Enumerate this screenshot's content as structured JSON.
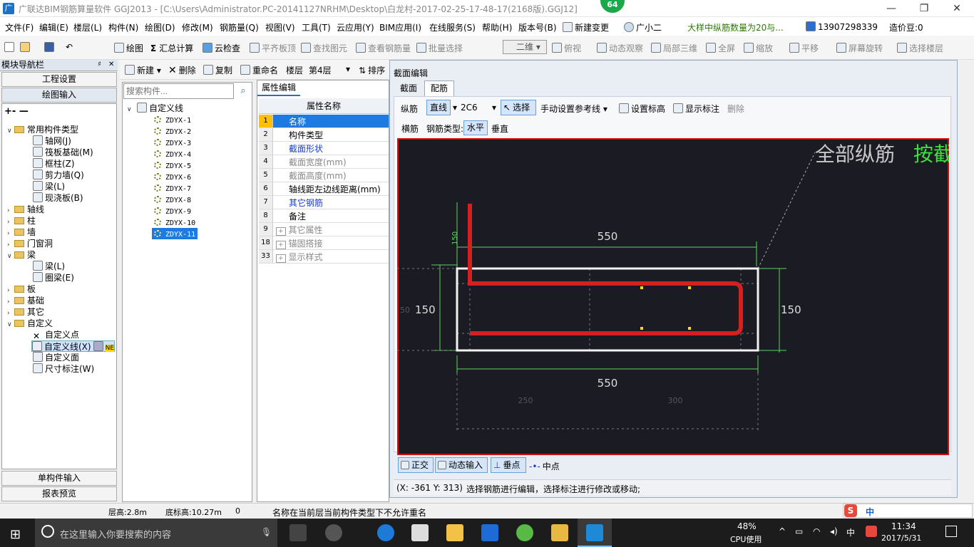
{
  "titlebar": {
    "app_icon": "广",
    "title": "广联达BIM钢筋算量软件 GGJ2013 - [C:\\Users\\Administrator.PC-20141127NRHM\\Desktop\\白龙村-2017-02-25-17-48-17(2168版).GGJ12]",
    "badge": "64",
    "minimize": "—",
    "maximize": "❐",
    "close": "✕"
  },
  "menu": {
    "items": [
      "文件(F)",
      "编辑(E)",
      "楼层(L)",
      "构件(N)",
      "绘图(D)",
      "修改(M)",
      "钢筋量(Q)",
      "视图(V)",
      "工具(T)",
      "云应用(Y)",
      "BIM应用(I)",
      "在线服务(S)",
      "帮助(H)",
      "版本号(B)",
      "新建变更",
      "广小二"
    ],
    "notice": "大样中纵筋数量为20与...",
    "phone": "13907298339",
    "price": "造价豆:0"
  },
  "toolbar": {
    "items": [
      "绘图",
      "汇总计算",
      "云检查",
      "平齐板顶",
      "查找图元",
      "查看钢筋量",
      "批量选择"
    ],
    "view_select": "二维",
    "items2": [
      "俯视",
      "动态观察",
      "局部三维",
      "全屏",
      "缩放",
      "平移",
      "屏幕旋转",
      "选择楼层"
    ]
  },
  "nav": {
    "header": "模块导航栏",
    "pin": "♯",
    "close": "✕",
    "engineering": "工程设置",
    "drawing_input": "绘图输入",
    "single_input": "单构件输入",
    "report_preview": "报表预览",
    "tree": [
      "常用构件类型",
      "轴网(J)",
      "筏板基础(M)",
      "框柱(Z)",
      "剪力墙(Q)",
      "梁(L)",
      "现浇板(B)",
      "轴线",
      "柱",
      "墙",
      "门窗洞",
      "梁",
      "梁(L)",
      "圈梁(E)",
      "板",
      "基础",
      "其它",
      "自定义",
      "自定义点",
      "自定义线(X)",
      "自定义面",
      "尺寸标注(W)"
    ],
    "ne_tag": "NE"
  },
  "comp": {
    "new": "新建",
    "delete": "删除",
    "copy": "复制",
    "rename": "重命名",
    "floor_label": "楼层",
    "floor": "第4层",
    "sort": "排序",
    "search_placeholder": "搜索构件...",
    "root": "自定义线",
    "items": [
      "ZDYX-1",
      "ZDYX-2",
      "ZDYX-3",
      "ZDYX-4",
      "ZDYX-5",
      "ZDYX-6",
      "ZDYX-7",
      "ZDYX-8",
      "ZDYX-9",
      "ZDYX-10",
      "ZDYX-11"
    ]
  },
  "props": {
    "tab": "属性编辑",
    "header": "属性名称",
    "rows": [
      {
        "n": "1",
        "v": "名称"
      },
      {
        "n": "2",
        "v": "构件类型"
      },
      {
        "n": "3",
        "v": "截面形状"
      },
      {
        "n": "4",
        "v": "截面宽度(mm)"
      },
      {
        "n": "5",
        "v": "截面高度(mm)"
      },
      {
        "n": "6",
        "v": "轴线距左边线距离(mm)"
      },
      {
        "n": "7",
        "v": "其它钢筋"
      },
      {
        "n": "8",
        "v": "备注"
      },
      {
        "n": "9",
        "v": "其它属性"
      },
      {
        "n": "18",
        "v": "锚固搭接"
      },
      {
        "n": "33",
        "v": "显示样式"
      }
    ]
  },
  "dialog": {
    "title": "截面编辑",
    "tab1": "截面",
    "tab2": "配筋",
    "long_label": "纵筋",
    "line": "直线",
    "rebar": "2C6",
    "select": "选择",
    "manual_ref": "手动设置参考线",
    "set_elev": "设置标高",
    "show_mark": "显示标注",
    "delete": "删除",
    "trans_label": "横筋",
    "rebar_type_label": "钢筋类型:",
    "horizontal": "水平",
    "vertical": "垂直",
    "canvas_text1": "全部纵筋",
    "canvas_text2": "按截",
    "dim_top": "550",
    "dim_bottom": "550",
    "dim_left": "150",
    "dim_right": "150",
    "dim_150v": "150",
    "dim_50": "50",
    "dim_250": "250",
    "dim_300": "300",
    "ortho": "正交",
    "dyn_input": "动态输入",
    "perp": "垂点",
    "mid": "中点",
    "coords": "(X: -361 Y: 313)",
    "hint": "选择钢筋进行编辑，选择标注进行修改或移动;"
  },
  "status": {
    "floor_h": "层高:2.8m",
    "base_h": "底标高:10.27m",
    "zero": "0",
    "msg": "名称在当前层当前构件类型下不允许重名"
  },
  "taskbar": {
    "search": "在这里输入你要搜索的内容",
    "cpu": "48%",
    "cpu_label": "CPU使用",
    "ime": "中",
    "time": "11:34",
    "date": "2017/5/31"
  }
}
